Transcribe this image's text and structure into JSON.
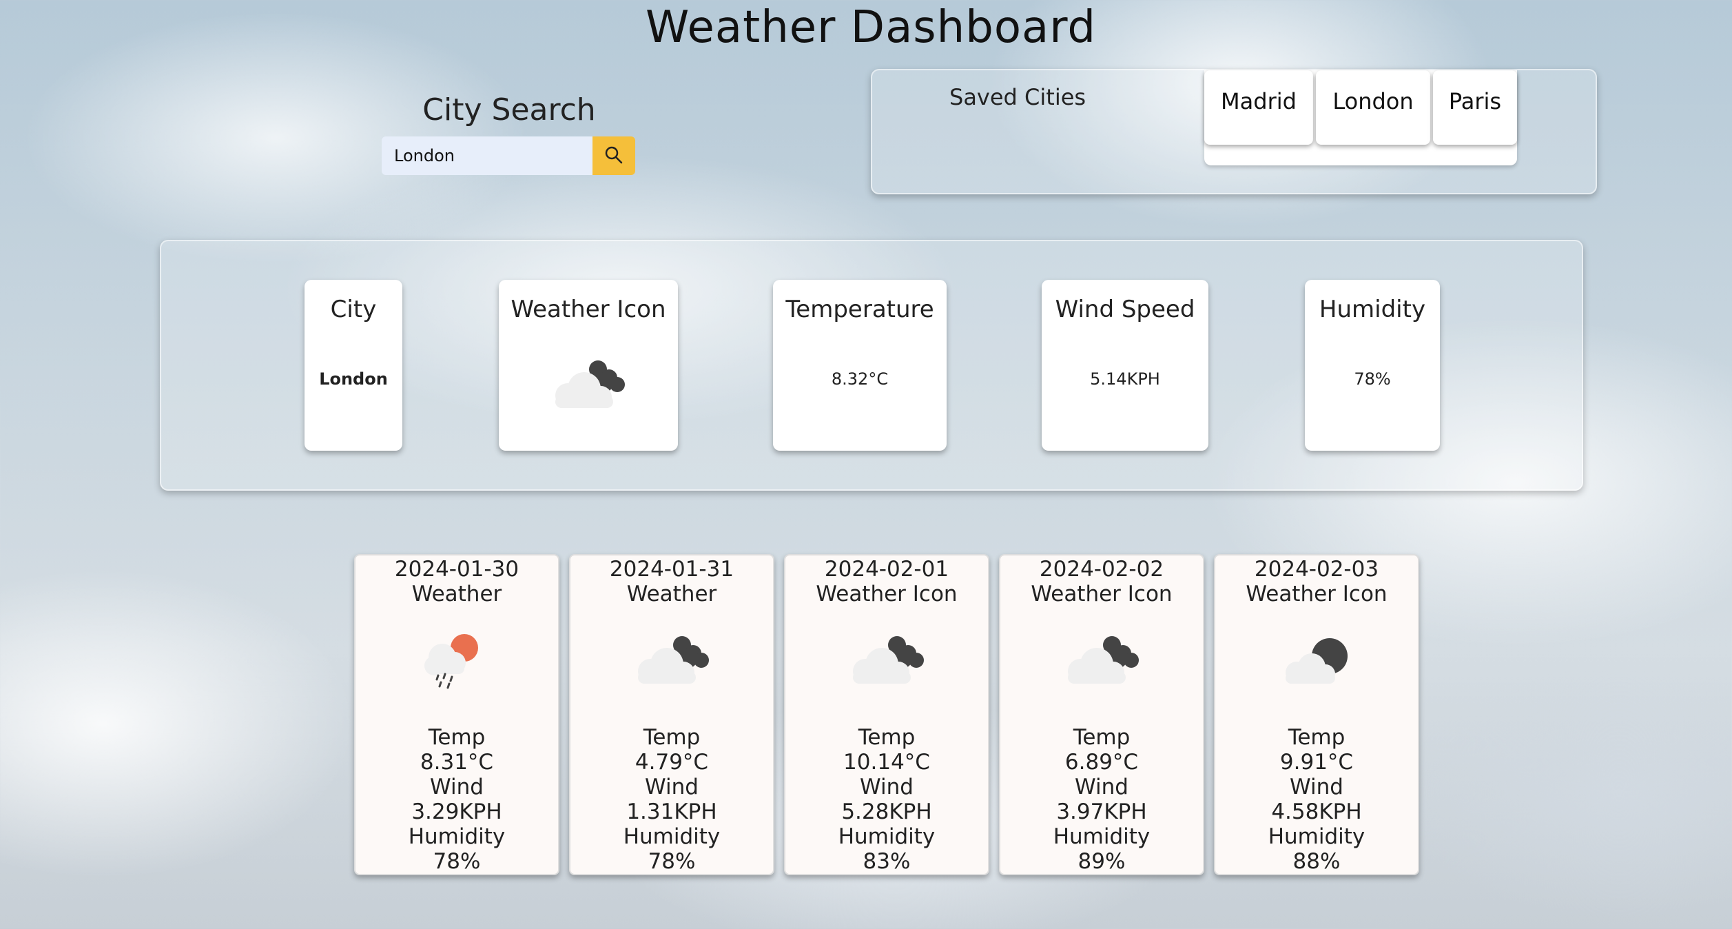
{
  "header": {
    "title": "Weather Dashboard"
  },
  "search": {
    "title": "City Search",
    "value": "London",
    "button_icon": "search-icon"
  },
  "saved": {
    "title": "Saved Cities",
    "cities": [
      "Madrid",
      "London",
      "Paris"
    ]
  },
  "current": {
    "city_label": "City",
    "city": "London",
    "icon_label": "Weather Icon",
    "icon": "cloudy-night-icon",
    "temp_label": "Temperature",
    "temp": "8.32°C",
    "wind_label": "Wind Speed",
    "wind": "5.14KPH",
    "humidity_label": "Humidity",
    "humidity": "78%"
  },
  "forecast": [
    {
      "date": "2024-01-30",
      "icon_label": "Weather",
      "icon": "rain-sun-icon",
      "temp_label": "Temp",
      "temp": "8.31°C",
      "wind_label": "Wind",
      "wind": "3.29KPH",
      "humidity_label": "Humidity",
      "humidity": "78%"
    },
    {
      "date": "2024-01-31",
      "icon_label": "Weather",
      "icon": "cloudy-night-icon",
      "temp_label": "Temp",
      "temp": "4.79°C",
      "wind_label": "Wind",
      "wind": "1.31KPH",
      "humidity_label": "Humidity",
      "humidity": "78%"
    },
    {
      "date": "2024-02-01",
      "icon_label": "Weather Icon",
      "icon": "cloudy-night-icon",
      "temp_label": "Temp",
      "temp": "10.14°C",
      "wind_label": "Wind",
      "wind": "5.28KPH",
      "humidity_label": "Humidity",
      "humidity": "83%"
    },
    {
      "date": "2024-02-02",
      "icon_label": "Weather Icon",
      "icon": "cloudy-night-icon",
      "temp_label": "Temp",
      "temp": "6.89°C",
      "wind_label": "Wind",
      "wind": "3.97KPH",
      "humidity_label": "Humidity",
      "humidity": "89%"
    },
    {
      "date": "2024-02-03",
      "icon_label": "Weather Icon",
      "icon": "partly-cloudy-night-icon",
      "temp_label": "Temp",
      "temp": "9.91°C",
      "wind_label": "Wind",
      "wind": "4.58KPH",
      "humidity_label": "Humidity",
      "humidity": "88%"
    }
  ],
  "colors": {
    "search_button": "#f5bf3a",
    "search_input_bg": "#e7eefa",
    "sun": "#e9704f"
  }
}
